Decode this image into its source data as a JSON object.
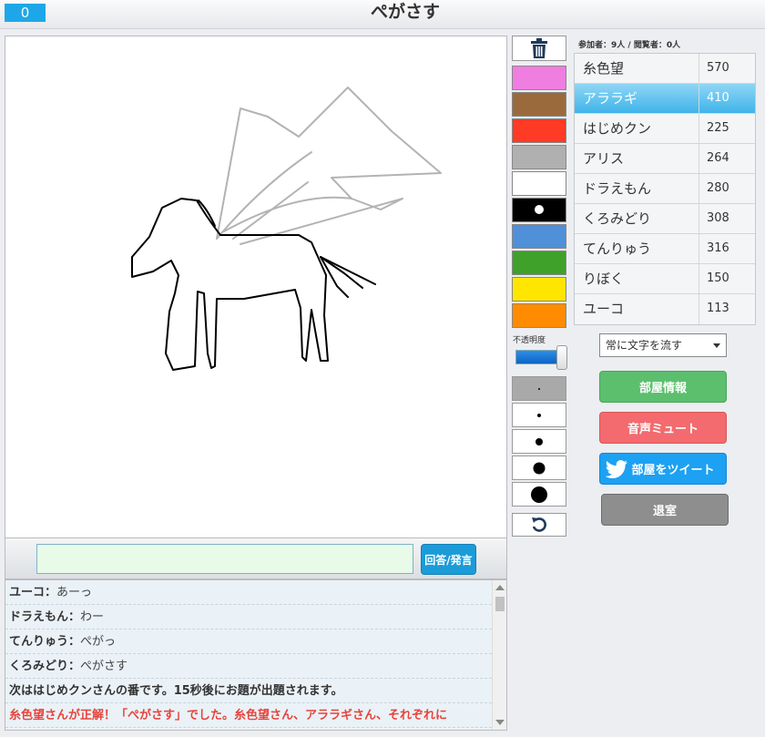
{
  "header": {
    "counter": "0",
    "title": "ぺがさす"
  },
  "chat": {
    "input_placeholder": "",
    "answer_button": "回答/発言",
    "messages": [
      {
        "type": "user",
        "name": "ユーコ",
        "text": "あーっ"
      },
      {
        "type": "user",
        "name": "ドラえもん",
        "text": "わー"
      },
      {
        "type": "user",
        "name": "てんりゅう",
        "text": "ぺがっ"
      },
      {
        "type": "user",
        "name": "くろみどり",
        "text": "ぺがさす"
      },
      {
        "type": "system",
        "text": "次ははじめクンさんの番です。15秒後にお題が出題されます。"
      },
      {
        "type": "correct",
        "text": "糸色望さんが正解！「ぺがさす」でした。糸色望さん、アララギさん、それぞれに"
      }
    ]
  },
  "tools": {
    "colors": [
      "#f07de0",
      "#9a6a3c",
      "#ff3a25",
      "#b0b0b0",
      "#ffffff",
      "#000000",
      "#5090d8",
      "#3fa02a",
      "#ffe600",
      "#ff8c00"
    ],
    "selected_color_index": 5,
    "opacity_label": "不透明度",
    "opacity_value": 1.0,
    "brush_sizes": [
      2,
      4,
      8,
      13,
      18
    ],
    "selected_brush_index": 0
  },
  "room": {
    "participants_label": "参加者：9人 / 閲覧者：0人",
    "players": [
      {
        "name": "糸色望",
        "score": "570",
        "active": false
      },
      {
        "name": "アララギ",
        "score": "410",
        "active": true
      },
      {
        "name": "はじめクン",
        "score": "225",
        "active": false
      },
      {
        "name": "アリス",
        "score": "264",
        "active": false
      },
      {
        "name": "ドラえもん",
        "score": "280",
        "active": false
      },
      {
        "name": "くろみどり",
        "score": "308",
        "active": false
      },
      {
        "name": "てんりゅう",
        "score": "316",
        "active": false
      },
      {
        "name": "りぼく",
        "score": "150",
        "active": false
      },
      {
        "name": "ユーコ",
        "score": "113",
        "active": false
      }
    ],
    "scroll_select": "常に文字を流す",
    "room_info_button": "部屋情報",
    "mute_button": "音声ミュート",
    "tweet_button": "部屋をツイート",
    "leave_button": "退室"
  }
}
